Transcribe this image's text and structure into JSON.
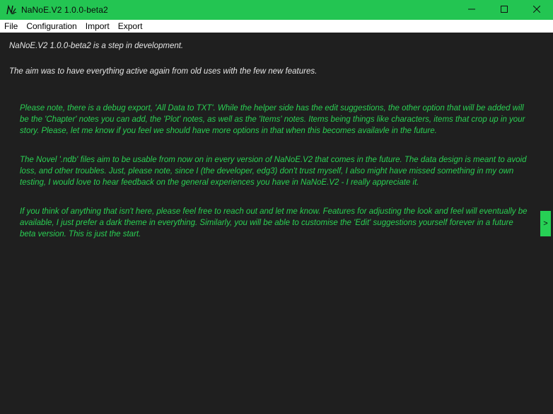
{
  "window": {
    "title": "NaNoE.V2 1.0.0-beta2",
    "icon": "nanoe-logo-icon",
    "controls": {
      "minimize_icon": "minimize-icon",
      "maximize_icon": "maximize-icon",
      "close_icon": "close-icon"
    }
  },
  "menubar": {
    "items": [
      "File",
      "Configuration",
      "Import",
      "Export"
    ]
  },
  "content": {
    "intro_1": "NaNoE.V2 1.0.0-beta2 is a step in development.",
    "intro_2": "The aim was to have everything active again from old uses with the few new features.",
    "note_1": "Please note, there is a debug export, 'All Data to TXT'. While the helper side has the edit suggestions, the other option that will be added will be the 'Chapter' notes you can add, the 'Plot' notes, as well as the 'Items' notes. Items being things like characters, items that crop up in your story. Please, let me know if you feel we should have more options in that when this becomes availavle in the future.",
    "note_2": "The Novel '.ndb' files aim to be usable from now on in every version of NaNoE.V2 that comes in the future. The data design is meant to avoid loss, and other troubles. Just, please note, since I (the developer, edg3) don't trust myself, I also might have missed something in my own testing, I would love to hear feedback on the general experiences you have in NaNoE.V2 - I really appreciate it.",
    "note_3": "If you think of anything that isn't here, please feel free to reach out and let me know. Features for adjusting the look and feel will eventually be available, I just prefer a dark theme in everything. Similarly, you will be able to customise the 'Edit' suggestions yourself forever in a future beta version. This is just the start."
  },
  "side_panel": {
    "toggle_label": ">"
  },
  "colors": {
    "titlebar": "#23c552",
    "background": "#1f1f1f",
    "accent_text": "#2ad053",
    "intro_text": "#e6e6e6"
  }
}
